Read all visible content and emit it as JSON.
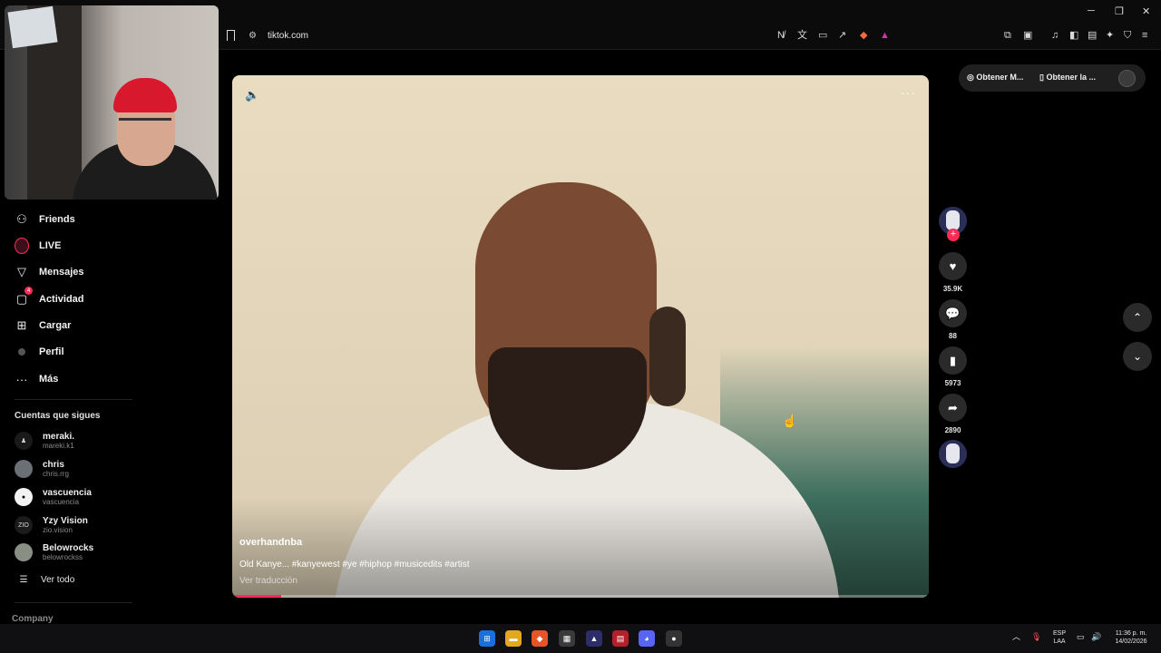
{
  "browser": {
    "url": "tiktok.com",
    "window_controls": [
      "─",
      "❐",
      "✕"
    ]
  },
  "sidebar": {
    "items": [
      {
        "label": "Friends",
        "icon": "friends-icon"
      },
      {
        "label": "LIVE",
        "icon": "live-icon"
      },
      {
        "label": "Mensajes",
        "icon": "messages-icon"
      },
      {
        "label": "Actividad",
        "icon": "activity-icon",
        "badge": "4"
      },
      {
        "label": "Cargar",
        "icon": "upload-icon"
      },
      {
        "label": "Perfil",
        "icon": "profile-icon"
      },
      {
        "label": "Más",
        "icon": "more-icon"
      }
    ],
    "following_title": "Cuentas que sigues",
    "following": [
      {
        "name": "meraki.",
        "user": "mareki.k1"
      },
      {
        "name": "chris",
        "user": "chris.rrg"
      },
      {
        "name": "vascuencia",
        "user": "vascuencia"
      },
      {
        "name": "Yzy Vision",
        "user": "zio.vision",
        "avatar_text": "ZIO"
      },
      {
        "name": "Belowrocks",
        "user": "belowrockss"
      }
    ],
    "see_all": "Ver todo",
    "company": "Company"
  },
  "video": {
    "author": "overhandnba",
    "caption": "Old Kanye... #kanyewest #ye #hiphop #musicedits #artist",
    "translate": "Ver traducción",
    "progress": 0.07
  },
  "actions": {
    "likes": "35.9K",
    "comments": "88",
    "saves": "5973",
    "shares": "2890"
  },
  "top_right": {
    "item1": "Obtener M...",
    "item2": "Obtener la ..."
  },
  "taskbar": {
    "lang": "ESP",
    "lang2": "LAA",
    "time": "11:36 p. m.",
    "date": "14/02/2026"
  }
}
